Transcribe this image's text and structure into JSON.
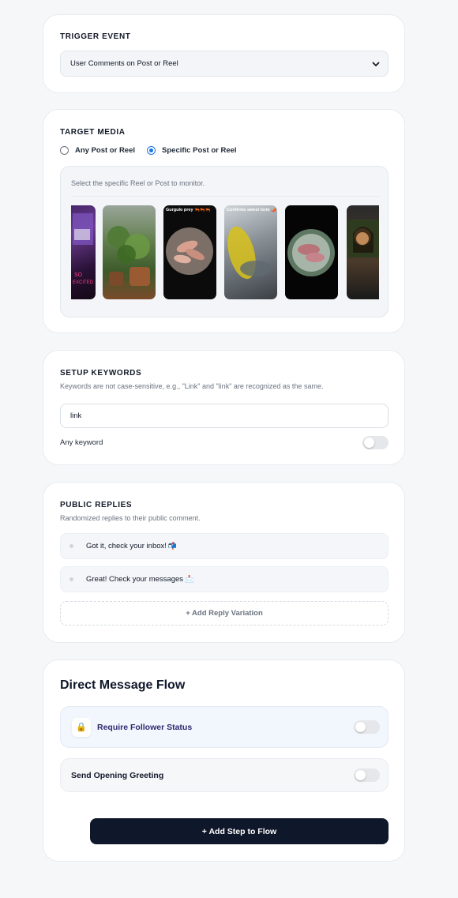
{
  "trigger": {
    "title": "TRIGGER EVENT",
    "selected": "User Comments on Post or Reel"
  },
  "target": {
    "title": "TARGET MEDIA",
    "options": [
      {
        "label": "Any Post or Reel",
        "checked": false
      },
      {
        "label": "Specific Post or Reel",
        "checked": true
      }
    ],
    "hint": "Select the specific Reel or Post to monitor.",
    "thumb_captions": [
      "Gurgulo prey 🦐🦐🦐",
      "Confirmo sweet Iorm 🌶️"
    ]
  },
  "keywords": {
    "title": "SETUP KEYWORDS",
    "subtitle": "Keywords are not case-sensitive, e.g., \"Link\" and \"link\" are recognized as the same.",
    "value": "link",
    "any_keyword_label": "Any keyword",
    "any_keyword_on": false
  },
  "replies": {
    "title": "PUBLIC REPLIES",
    "subtitle": "Randomized replies to their public comment.",
    "items": [
      {
        "text": "Got it, check your inbox!",
        "emoji": "📬"
      },
      {
        "text": "Great! Check your messages",
        "emoji": "📩"
      }
    ],
    "add_label": "+ Add Reply Variation"
  },
  "dm": {
    "title": "Direct Message Flow",
    "follower_label": "Require Follower Status",
    "follower_icon": "🔒",
    "greeting_label": "Send Opening Greeting",
    "add_step_label": "+ Add Step to Flow"
  },
  "colors": {
    "accent_blue": "#1a73e8",
    "primary_dark": "#0f172a"
  }
}
